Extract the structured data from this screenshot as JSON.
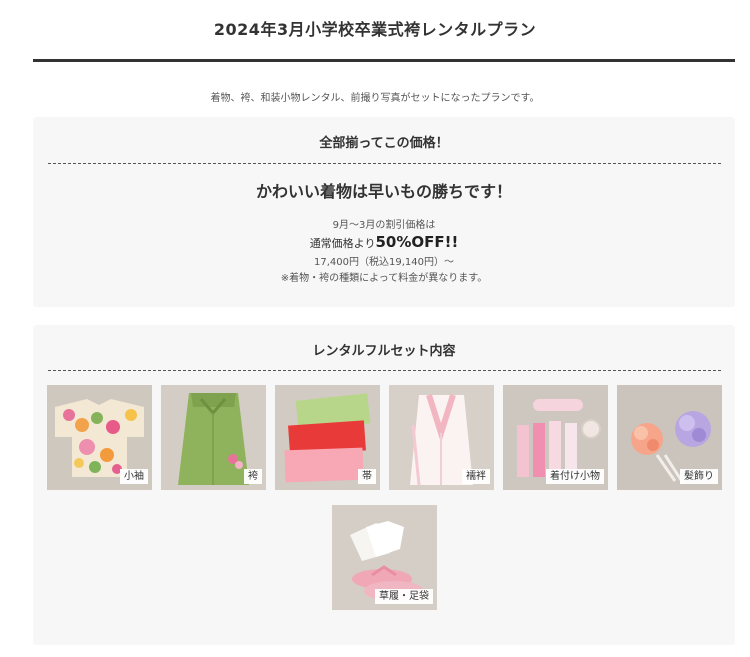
{
  "page": {
    "title": "2024年3月小学校卒業式袴レンタルプラン",
    "intro": "着物、袴、和装小物レンタル、前撮り写真がセットになったプランです。"
  },
  "price_panel": {
    "heading": "全部揃ってこの価格！",
    "catch": "かわいい着物は早いもの勝ちです！",
    "period": "9月～3月の割引価格は",
    "normal_prefix": "通常価格より",
    "discount": "50%OFF!!",
    "price": "17,400円（税込19,140円）～",
    "note": "※着物・袴の種類によって料金が異なります。"
  },
  "set_panel": {
    "heading": "レンタルフルセット内容",
    "items": [
      {
        "label": "小袖",
        "icon": "kimono-photo"
      },
      {
        "label": "袴",
        "icon": "hakama-photo"
      },
      {
        "label": "帯",
        "icon": "obi-photo"
      },
      {
        "label": "襦袢",
        "icon": "juban-photo"
      },
      {
        "label": "着付け小物",
        "icon": "kitsuke-accessories-photo"
      },
      {
        "label": "髪飾り",
        "icon": "hair-ornament-photo"
      },
      {
        "label": "草履・足袋",
        "icon": "zori-tabi-photo"
      }
    ]
  },
  "colors": {
    "panel_bg": "#f7f7f7",
    "text": "#333333",
    "rule": "#333333"
  }
}
